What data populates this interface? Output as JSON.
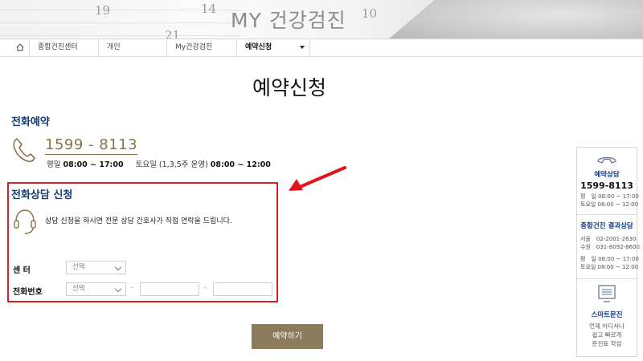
{
  "banner": {
    "title": "MY 건강검진",
    "calendar_numbers": [
      "19",
      "14",
      "10",
      "21"
    ]
  },
  "breadcrumb": {
    "items": [
      "종합건진센터",
      "개인",
      "My건강검진",
      "예약신청"
    ]
  },
  "page": {
    "title": "예약신청"
  },
  "phone_reservation": {
    "title": "전화예약",
    "number": "1599 - 8113",
    "weekday_label": "평일",
    "weekday_hours": "08:00 ~ 17:00",
    "saturday_label": "토요일 (1,3,5주 운영)",
    "saturday_hours": "08:00 ~ 12:00"
  },
  "consult": {
    "title": "전화상담 신청",
    "description": "상담 신청을 하시면 전문 상담 간호사가 직접 연락을 드립니다.",
    "center_label": "센 터",
    "center_select": "선택",
    "phone_label": "전화번호",
    "phone_select": "선택",
    "separator": "–"
  },
  "submit_label": "예약하기",
  "side": {
    "reservation_title": "예약상담",
    "reservation_number": "1599-8113",
    "reservation_weekday": "평　일 08:00 ~ 17:00",
    "reservation_saturday": "토요일 08:00 ~ 12:00",
    "result_title": "종합건진 결과상담",
    "seoul": "서울　02-2001-2630",
    "suwon": "수원　031-8092-8600",
    "result_weekday": "평　일 08:00 ~ 17:00",
    "result_saturday": "토요일 08:00 ~ 12:00",
    "smart_title": "스마트문진",
    "smart_line1": "언제 어디서나",
    "smart_line2": "쉽고 빠르게",
    "smart_line3": "문진표 작성"
  },
  "colors": {
    "accent_gold": "#8a7248",
    "navy": "#123b7a",
    "highlight_red": "#d61f26",
    "button_brown": "#8c7a5d"
  },
  "icons": [
    "home-icon",
    "phone-icon",
    "headset-icon",
    "chevron-down-icon",
    "arrow-icon",
    "document-icon"
  ]
}
